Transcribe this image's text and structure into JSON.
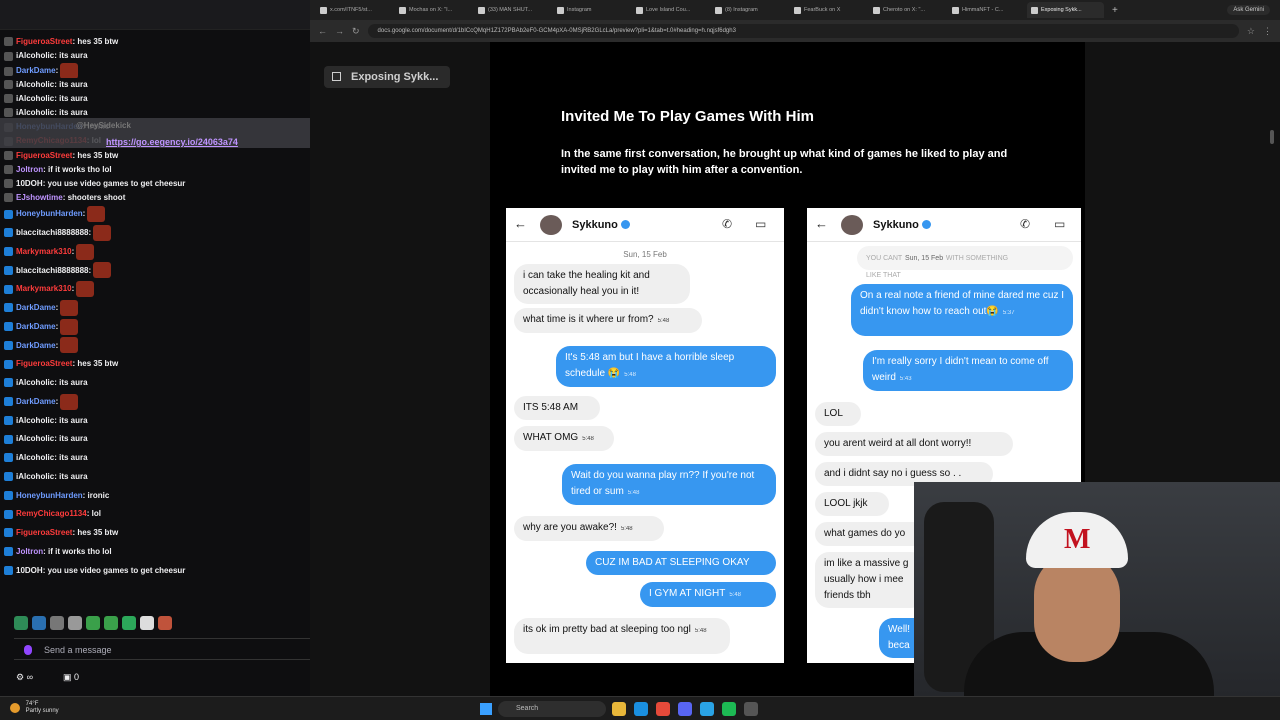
{
  "chat": {
    "messages": [
      {
        "user": "FigueroaStreet",
        "color": "red",
        "text": ": hes 35 btw"
      },
      {
        "user": "iAlcoholic",
        "color": "white",
        "text": ": its aura"
      },
      {
        "user": "DarkDame",
        "color": "blue",
        "text": ":"
      },
      {
        "user": "iAlcoholic",
        "color": "white",
        "text": ": its aura"
      },
      {
        "user": "iAlcoholic",
        "color": "white",
        "text": ": its aura"
      },
      {
        "user": "iAlcoholic",
        "color": "white",
        "text": ": its aura"
      },
      {
        "user": "HoneybunHarden",
        "color": "blue",
        "text": ": ironic"
      },
      {
        "user": "RemyChicago1134",
        "color": "red",
        "text": ": lol"
      },
      {
        "user": "FigueroaStreet",
        "color": "red",
        "text": ": hes 35 btw"
      },
      {
        "user": "Joltron",
        "color": "purple",
        "text": ": if it works tho lol"
      },
      {
        "user": "10DOH",
        "color": "white",
        "text": ": you use video games to get cheesur"
      },
      {
        "user": "EJshowtime",
        "color": "purple",
        "text": ": shooters shoot"
      }
    ],
    "messages2": [
      {
        "user": "HoneybunHarden",
        "color": "blue",
        "text": ":"
      },
      {
        "user": "blaccitachi8888888",
        "color": "white",
        "text": ":"
      },
      {
        "user": "Markymark310",
        "color": "red",
        "text": ":"
      },
      {
        "user": "blaccitachi8888888",
        "color": "white",
        "text": ":"
      },
      {
        "user": "Markymark310",
        "color": "red",
        "text": ":"
      },
      {
        "user": "DarkDame",
        "color": "blue",
        "text": ":"
      },
      {
        "user": "DarkDame",
        "color": "blue",
        "text": ":"
      },
      {
        "user": "DarkDame",
        "color": "blue",
        "text": ":"
      },
      {
        "user": "FigueroaStreet",
        "color": "red",
        "text": ": hes 35 btw"
      },
      {
        "user": "iAlcoholic",
        "color": "white",
        "text": ": its aura"
      },
      {
        "user": "DarkDame",
        "color": "blue",
        "text": ":"
      },
      {
        "user": "iAlcoholic",
        "color": "white",
        "text": ": its aura"
      },
      {
        "user": "iAlcoholic",
        "color": "white",
        "text": ": its aura"
      },
      {
        "user": "iAlcoholic",
        "color": "white",
        "text": ": its aura"
      },
      {
        "user": "iAlcoholic",
        "color": "white",
        "text": ": its aura"
      },
      {
        "user": "HoneybunHarden",
        "color": "blue",
        "text": ": ironic"
      },
      {
        "user": "RemyChicago1134",
        "color": "red",
        "text": ": lol"
      },
      {
        "user": "FigueroaStreet",
        "color": "red",
        "text": ": hes 35 btw"
      },
      {
        "user": "Joltron",
        "color": "purple",
        "text": ": if it works tho lol"
      },
      {
        "user": "10DOH",
        "color": "white",
        "text": ": you use video games to get cheesur"
      }
    ],
    "pinned_user": "@HeySidekick",
    "pinned_link": "https://go.eegency.io/24063a74",
    "input_placeholder": "Send a message",
    "footer_points": "0"
  },
  "browser": {
    "tabs": [
      {
        "label": "x.com/ITNF5/st..."
      },
      {
        "label": "Mochas on X: \"I..."
      },
      {
        "label": "(33) MAN SHUT..."
      },
      {
        "label": "Instagram"
      },
      {
        "label": "Love Island Cou..."
      },
      {
        "label": "(8) Instagram"
      },
      {
        "label": "FearBuck on X"
      },
      {
        "label": "Cheroto on X: \"..."
      },
      {
        "label": "HimmaNFT - C..."
      },
      {
        "label": "Exposing Sykk..."
      }
    ],
    "gemini": "Ask Gemini",
    "url": "docs.google.com/document/d/1bICcQMqH1Z172PBAb2eF0-GCM4pXA-0MSjRB2GLcLa/preview?pli=1&tab=t.0#heading=h.nqjsf6dgh3"
  },
  "doc": {
    "outline_label": "Exposing Sykk...",
    "title": "Invited Me To Play Games With Him",
    "paragraph": "In the same first conversation, he brought up what kind of games he liked to play and invited me to play with him after a convention."
  },
  "phone1": {
    "name": "Sykkuno",
    "date": "Sun, 15 Feb",
    "messages": [
      {
        "dir": "in",
        "text": "i can take the healing kit and occasionally heal you in it!",
        "time": ""
      },
      {
        "dir": "in",
        "text": "what time is it where ur from?",
        "time": "5:48"
      },
      {
        "dir": "out",
        "text": "It's 5:48 am but I have a horrible sleep schedule 😭",
        "time": "5:48"
      },
      {
        "dir": "in",
        "text": "ITS 5:48 AM",
        "time": ""
      },
      {
        "dir": "in",
        "text": "WHAT OMG",
        "time": "5:48"
      },
      {
        "dir": "out",
        "text": "Wait do you wanna play rn?? If you're not tired or sum",
        "time": "5:48"
      },
      {
        "dir": "in",
        "text": "why are you awake?!",
        "time": "5:48"
      },
      {
        "dir": "out",
        "text": "CUZ IM BAD AT SLEEPING OKAY",
        "time": ""
      },
      {
        "dir": "out",
        "text": "I GYM AT NIGHT",
        "time": "5:48"
      },
      {
        "dir": "in",
        "text": "its ok im pretty bad at sleeping too ngl",
        "time": "5:48"
      }
    ]
  },
  "phone2": {
    "name": "Sykkuno",
    "date": "Sun, 15 Feb",
    "header_faded": "YOU CANT",
    "header_faded2": "LIKE THAT",
    "header_faded3": "WITH SOMETHING",
    "messages": [
      {
        "dir": "out",
        "text": "On a real note a friend of mine dared me cuz I didn't know how to reach out😭",
        "time": "5:37"
      },
      {
        "dir": "out",
        "text": "I'm really sorry I didn't mean to come off weird",
        "time": "5:43"
      },
      {
        "dir": "in",
        "text": "LOL",
        "time": ""
      },
      {
        "dir": "in",
        "text": "you arent weird at all dont worry!!",
        "time": ""
      },
      {
        "dir": "in",
        "text": "and i didnt say no i guess so . .",
        "time": ""
      },
      {
        "dir": "in",
        "text": "LOOL jkjk",
        "time": ""
      },
      {
        "dir": "in",
        "text": "what games do yo",
        "time": ""
      },
      {
        "dir": "in",
        "text": "im like a massive g usually how i mee friends tbh",
        "time": ""
      },
      {
        "dir": "out",
        "text": "Well! beca",
        "time": ""
      }
    ]
  },
  "taskbar": {
    "weather_temp": "74°F",
    "weather_desc": "Partly sunny",
    "search_placeholder": "Search"
  },
  "colors": {
    "chat_bg": "#0e0e10",
    "ig_blue": "#3797f0",
    "doc_bg": "#121212"
  }
}
